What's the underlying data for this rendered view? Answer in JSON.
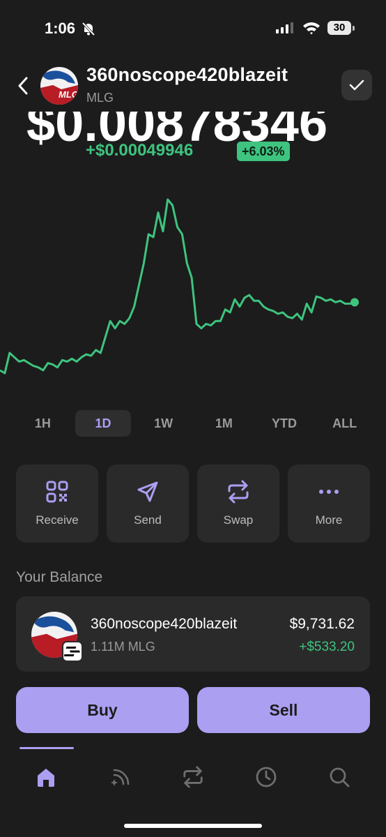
{
  "status_bar": {
    "time": "1:06",
    "battery": "30"
  },
  "token": {
    "name": "360noscope420blazeit",
    "symbol": "MLG",
    "logo_text": "MLG"
  },
  "price": {
    "value": "$0.00878346",
    "change_amount": "+$0.00049946",
    "change_percent": "+6.03%"
  },
  "chart_data": {
    "type": "line",
    "title": "",
    "xlabel": "",
    "ylabel": "",
    "range": "1D",
    "values": [
      0.00826,
      0.00824,
      0.00838,
      0.00835,
      0.00832,
      0.00833,
      0.00831,
      0.00829,
      0.00828,
      0.00826,
      0.00831,
      0.0083,
      0.00828,
      0.00833,
      0.00832,
      0.00834,
      0.00832,
      0.00835,
      0.00837,
      0.00836,
      0.0084,
      0.00838,
      0.00849,
      0.0086,
      0.00855,
      0.0086,
      0.00858,
      0.00862,
      0.0087,
      0.00885,
      0.009,
      0.0092,
      0.00918,
      0.00935,
      0.00922,
      0.00944,
      0.0094,
      0.00925,
      0.0092,
      0.009,
      0.0089,
      0.00858,
      0.00855,
      0.00858,
      0.00857,
      0.0086,
      0.0086,
      0.00868,
      0.00866,
      0.00875,
      0.0087,
      0.00876,
      0.00878,
      0.00874,
      0.00874,
      0.0087,
      0.00868,
      0.00867,
      0.00865,
      0.00866,
      0.00863,
      0.00862,
      0.00865,
      0.00861,
      0.00872,
      0.00866,
      0.00877,
      0.00876,
      0.00874,
      0.00875,
      0.00873,
      0.00874,
      0.00872,
      0.00872,
      0.00873
    ],
    "line_color": "#3ec47f"
  },
  "ranges": [
    {
      "label": "1H",
      "active": false
    },
    {
      "label": "1D",
      "active": true
    },
    {
      "label": "1W",
      "active": false
    },
    {
      "label": "1M",
      "active": false
    },
    {
      "label": "YTD",
      "active": false
    },
    {
      "label": "ALL",
      "active": false
    }
  ],
  "actions": [
    {
      "label": "Receive",
      "icon": "qr-code-icon"
    },
    {
      "label": "Send",
      "icon": "send-icon"
    },
    {
      "label": "Swap",
      "icon": "swap-icon"
    },
    {
      "label": "More",
      "icon": "more-icon"
    }
  ],
  "balance": {
    "title": "Your Balance",
    "name": "360noscope420blazeit",
    "quantity": "1.11M MLG",
    "value": "$9,731.62",
    "change": "+$533.20"
  },
  "buttons": {
    "buy": "Buy",
    "sell": "Sell"
  },
  "colors": {
    "accent": "#ab9ff2",
    "positive": "#3ec47f",
    "background": "#1c1c1c",
    "card": "#2a2a2a"
  }
}
